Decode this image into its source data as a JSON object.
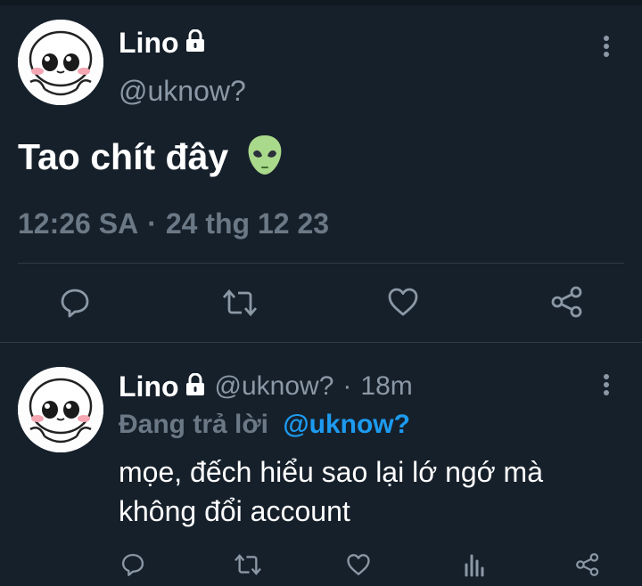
{
  "main_tweet": {
    "author_name": "Lino",
    "author_handle": "@uknow?",
    "text": "Tao chít đây",
    "emoji": "alien-emoji",
    "time": "12:26 SA",
    "date": "24 thg 12 23",
    "meta_separator": "·",
    "actions": [
      "reply-icon",
      "retweet-icon",
      "like-icon",
      "share-icon"
    ]
  },
  "reply": {
    "author_name": "Lino",
    "author_handle": "@uknow?",
    "age_separator": "·",
    "age": "18m",
    "replying_label": "Đang trả lời",
    "replying_mention": "@uknow?",
    "text_line1": "mọe, đếch hiểu sao lại lớ ngớ mà",
    "text_line2": "không đổi account",
    "actions": [
      "reply-icon",
      "retweet-icon",
      "like-icon",
      "analytics-icon",
      "share-icon"
    ]
  },
  "colors": {
    "background": "#16202b",
    "muted_text": "#8b98a5",
    "mention": "#1d9bf0",
    "icon": "#8b98a5"
  }
}
